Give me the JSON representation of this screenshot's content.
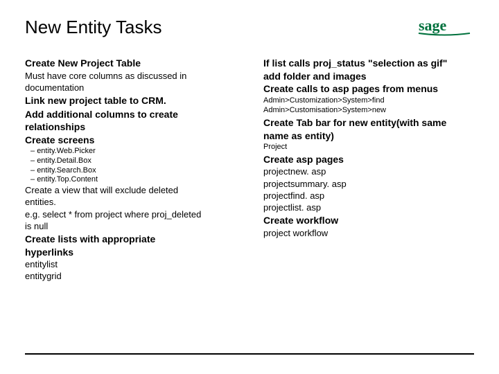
{
  "header": {
    "title": "New Entity Tasks",
    "logo_text": "sage"
  },
  "left": {
    "h1": "Create New Project Table",
    "p1a": "Must have core columns as discussed in",
    "p1b": "documentation",
    "h2": "Link new project table to CRM.",
    "h3a": "Add additional columns to create",
    "h3b": "relationships",
    "h4": "Create screens",
    "list": {
      "i1": "entity.Web.Picker",
      "i2": "entity.Detail.Box",
      "i3": "entity.Search.Box",
      "i4": "entity.Top.Content"
    },
    "p2a": "Create a view that will exclude deleted",
    "p2b": "entities.",
    "p2c": "e.g. select * from project where proj_deleted",
    "p2d": "is null",
    "h5a": "Create lists with appropriate",
    "h5b": "hyperlinks",
    "p3a": "entitylist",
    "p3b": "entitygrid"
  },
  "right": {
    "h1a": "If list calls proj_status \"selection as gif\"",
    "h1b": "add folder and images",
    "h2": "Create calls to asp pages from menus",
    "p1a": "Admin>Customization>System>find",
    "p1b": "Admin>Customisation>System>new",
    "h3a": "Create Tab bar for new entity(with same",
    "h3b": "name as entity)",
    "p2": "Project",
    "h4": "Create asp pages",
    "p3a": "projectnew. asp",
    "p3b": "projectsummary. asp",
    "p3c": "projectfind. asp",
    "p3d": "projectlist. asp",
    "h5": "Create workflow",
    "p4": "project workflow"
  }
}
